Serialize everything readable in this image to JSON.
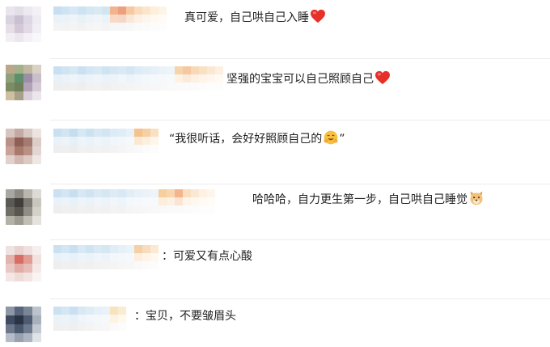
{
  "comments": [
    {
      "text": "真可爱，自己哄自己入睡",
      "emoji": "red-heart",
      "emoji_color": "#e8302a"
    },
    {
      "text": "坚强的宝宝可以自己照顾自己",
      "emoji": "red-heart",
      "emoji_color": "#e8302a"
    },
    {
      "text": "“我很听话，会好好照顾自己的",
      "emoji": "smiling-hands-face",
      "text_after": "”",
      "emoji_color": "#f5b62f"
    },
    {
      "text": "哈哈哈，自力更生第一步，自己哄自己睡觉",
      "emoji": "doge-face",
      "emoji_color": "#f2b75a"
    },
    {
      "text": "：可爱又有点心酸"
    },
    {
      "text": "：宝贝，不要皱眉头"
    }
  ]
}
